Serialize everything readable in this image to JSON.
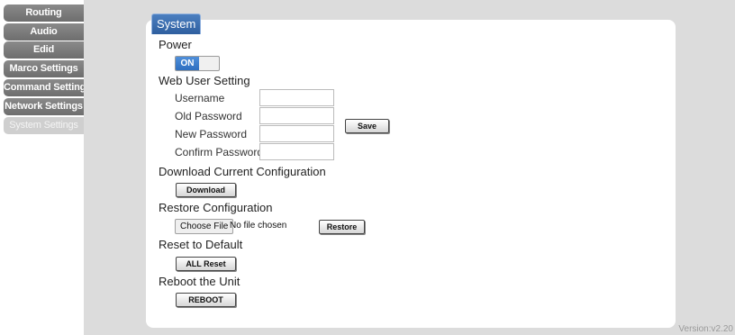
{
  "sidebar": {
    "items": [
      {
        "label": "Routing",
        "active": false
      },
      {
        "label": "Audio",
        "active": false
      },
      {
        "label": "Edid",
        "active": false
      },
      {
        "label": "Marco Settings",
        "active": false
      },
      {
        "label": "Command Settings",
        "active": false
      },
      {
        "label": "Network Settings",
        "active": false
      },
      {
        "label": "System Settings",
        "active": true
      }
    ]
  },
  "panel": {
    "title": "System"
  },
  "power": {
    "heading": "Power",
    "toggle_label": "ON",
    "state": "on"
  },
  "web_user": {
    "heading": "Web User Setting",
    "username_label": "Username",
    "old_password_label": "Old Password",
    "new_password_label": "New Password",
    "confirm_password_label": "Confirm Password",
    "username_value": "",
    "old_password_value": "",
    "new_password_value": "",
    "confirm_password_value": "",
    "save_label": "Save"
  },
  "download": {
    "heading": "Download Current Configuration",
    "button_label": "Download"
  },
  "restore": {
    "heading": "Restore Configuration",
    "choose_file_label": "Choose File",
    "file_status": "No file chosen",
    "button_label": "Restore"
  },
  "reset": {
    "heading": "Reset to Default",
    "button_label": "ALL Reset"
  },
  "reboot": {
    "heading": "Reboot the Unit",
    "button_label": "REBOOT"
  },
  "footer": {
    "version": "Version:v2.20"
  },
  "colors": {
    "accent": "#2f6fc0",
    "sidebar": "#7a7a7a",
    "sidebar_active": "#cfcfcf",
    "background": "#dcdcdc"
  }
}
